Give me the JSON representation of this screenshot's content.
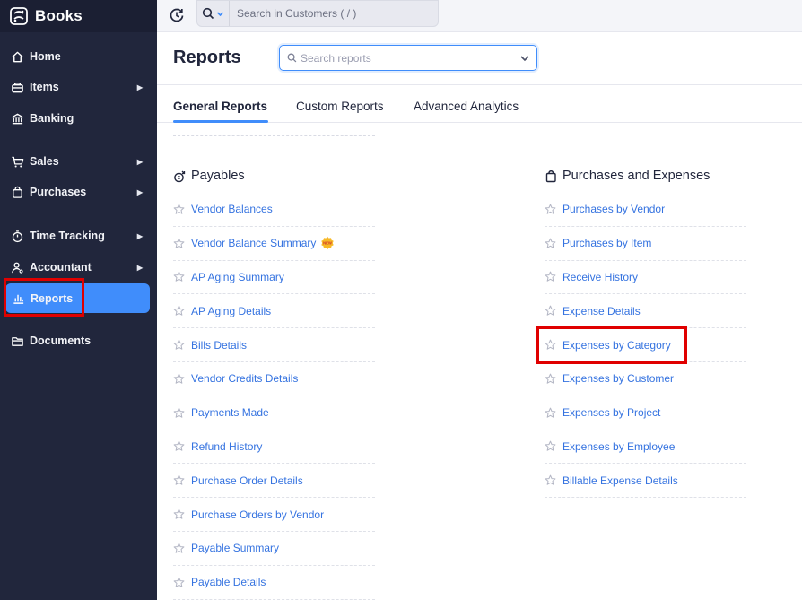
{
  "app": {
    "name": "Books"
  },
  "sidebar": {
    "items": [
      {
        "label": "Home",
        "icon": "home-icon",
        "has_submenu": false
      },
      {
        "label": "Items",
        "icon": "items-icon",
        "has_submenu": true
      },
      {
        "label": "Banking",
        "icon": "bank-icon",
        "has_submenu": false
      },
      {
        "label": "Sales",
        "icon": "cart-icon",
        "has_submenu": true
      },
      {
        "label": "Purchases",
        "icon": "bag-icon",
        "has_submenu": true
      },
      {
        "label": "Time Tracking",
        "icon": "timer-icon",
        "has_submenu": true
      },
      {
        "label": "Accountant",
        "icon": "accountant-icon",
        "has_submenu": true
      },
      {
        "label": "Reports",
        "icon": "bar-chart-icon",
        "has_submenu": false,
        "active": true
      },
      {
        "label": "Documents",
        "icon": "folder-icon",
        "has_submenu": false
      }
    ],
    "arrow_glyph": "▶"
  },
  "topbar": {
    "search_placeholder": "Search in Customers ( / )"
  },
  "header": {
    "title": "Reports",
    "search_placeholder": "Search reports"
  },
  "tabs": [
    {
      "label": "General Reports",
      "active": true
    },
    {
      "label": "Custom Reports",
      "active": false
    },
    {
      "label": "Advanced Analytics",
      "active": false
    }
  ],
  "sections": {
    "payables": {
      "title": "Payables",
      "reports": [
        "Vendor Balances",
        "Vendor Balance Summary",
        "AP Aging Summary",
        "AP Aging Details",
        "Bills Details",
        "Vendor Credits Details",
        "Payments Made",
        "Refund History",
        "Purchase Order Details",
        "Purchase Orders by Vendor",
        "Payable Summary",
        "Payable Details"
      ],
      "new_badge_on": "Vendor Balance Summary",
      "new_badge_text": "NEW"
    },
    "purchases": {
      "title": "Purchases and Expenses",
      "reports": [
        "Purchases by Vendor",
        "Purchases by Item",
        "Receive History",
        "Expense Details",
        "Expenses by Category",
        "Expenses by Customer",
        "Expenses by Project",
        "Expenses by Employee",
        "Billable Expense Details"
      ]
    }
  },
  "colors": {
    "sidebar_bg": "#21263c",
    "accent": "#408dfb",
    "link": "#3573e0",
    "highlight": "#e00000"
  }
}
